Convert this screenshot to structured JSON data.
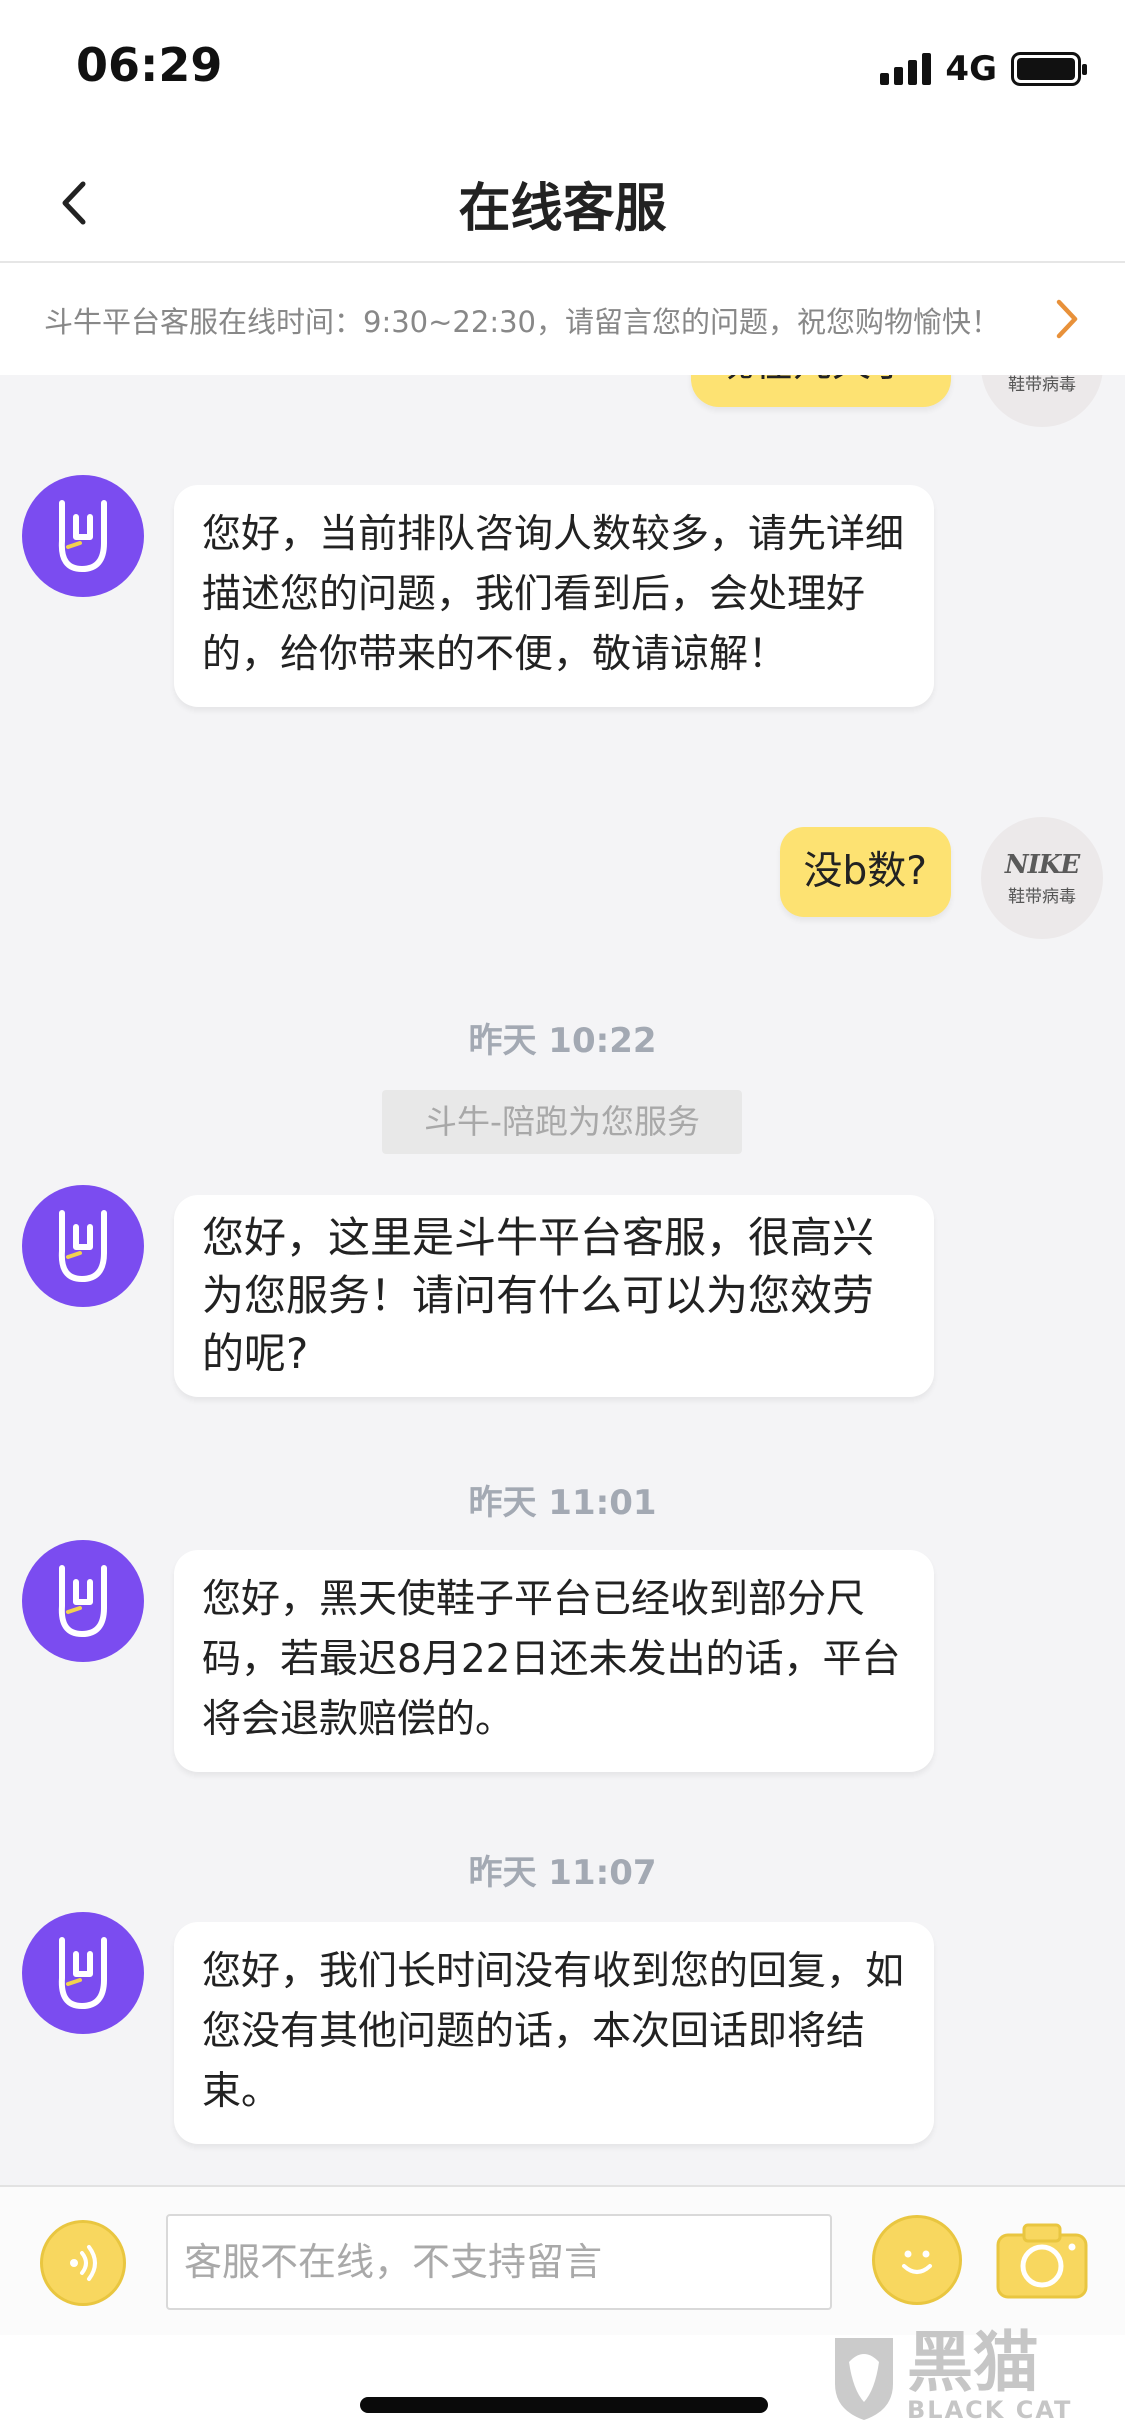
{
  "status_bar": {
    "time": "06:29",
    "network": "4G"
  },
  "nav": {
    "title": "在线客服"
  },
  "notice": {
    "text": "斗牛平台客服在线时间：9:30~22:30，请留言您的问题，祝您购物愉快！"
  },
  "messages": {
    "partial_user": "现在几天了",
    "agent_1": "您好，当前排队咨询人数较多，请先详细描述您的问题，我们看到后，会处理好的，给你带来的不便，敬请谅解！",
    "user_1": "没b数?",
    "time_1": "昨天 10:22",
    "system_1": "斗牛-陪跑为您服务",
    "agent_2": "您好，这里是斗牛平台客服，很高兴为您服务！请问有什么可以为您效劳的呢?",
    "time_2": "昨天 11:01",
    "agent_3": "您好，黑天使鞋子平台已经收到部分尺码，若最迟8月22日还未发出的话，平台将会退款赔偿的。",
    "time_3": "昨天 11:07",
    "agent_4": "您好，我们长时间没有收到您的回复，如您没有其他问题的话，本次回话即将结束。"
  },
  "user_avatar": {
    "logo": "NIKE",
    "sub": "鞋带病毒"
  },
  "input": {
    "placeholder": "客服不在线，不支持留言"
  },
  "watermark": {
    "cn": "黑猫",
    "en": "BLACK CAT"
  },
  "colors": {
    "accent_yellow": "#fde272",
    "agent_purple": "#7b4cf0",
    "notice_arrow": "#e8913a"
  },
  "icons": {
    "back": "chevron-left-icon",
    "notice_arrow": "chevron-right-icon",
    "voice": "voice-icon",
    "emoji": "smiley-icon",
    "camera": "camera-icon",
    "agent_avatar": "rock-hand-icon"
  }
}
